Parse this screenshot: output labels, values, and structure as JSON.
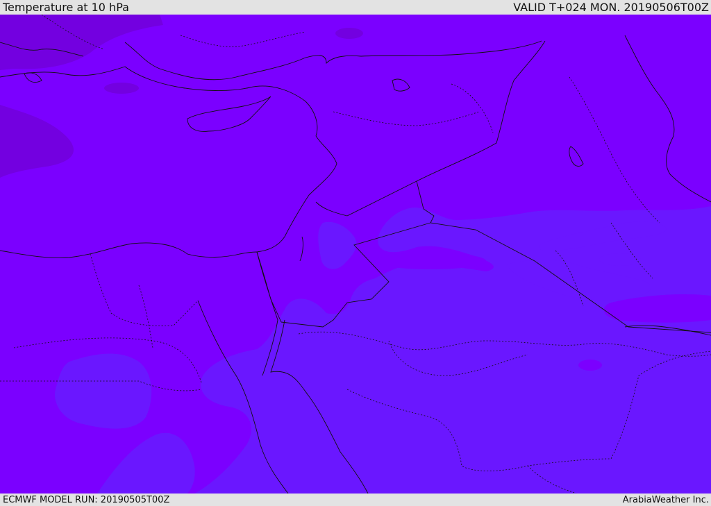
{
  "header": {
    "title": "Temperature at 10 hPa",
    "valid": "VALID T+024 MON. 20190506T00Z"
  },
  "footer": {
    "model_run": "ECMWF MODEL RUN: 20190505T00Z",
    "credit": "ArabiaWeather Inc."
  },
  "colors": {
    "warm": "#7b00ff",
    "dark": "#7300e0",
    "cool": "#6a17ff",
    "coast": "#111111",
    "bar": "#e3e3e3"
  }
}
